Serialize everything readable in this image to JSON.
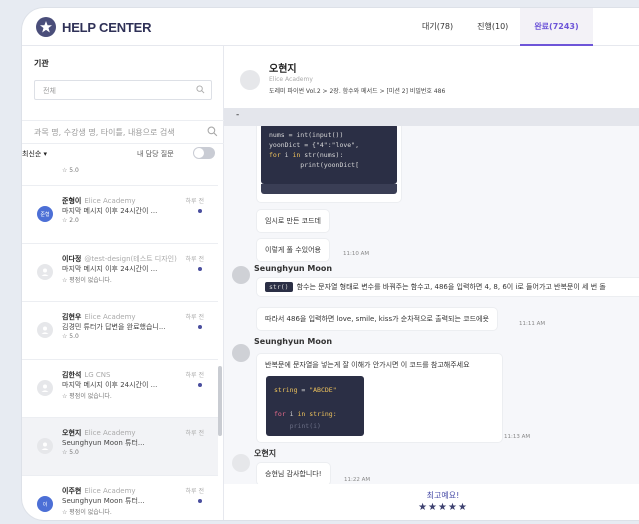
{
  "header": {
    "logo_text": "HELP CENTER",
    "tabs": [
      {
        "label": "대기(78)"
      },
      {
        "label": "진행(10)"
      },
      {
        "label": "완료(7243)"
      }
    ]
  },
  "sidebar": {
    "org_label": "기관",
    "org_value": "전체",
    "search_placeholder": "과목 명, 수강생 명, 타이틀, 내용으로 검색",
    "sort_label": "최신순 ▾",
    "mine_label": "내 담당 질문",
    "items": [
      {
        "name": "",
        "org": "",
        "time": "",
        "preview": "",
        "rating": "☆ 5.0",
        "avatar": "",
        "dot": false
      },
      {
        "name": "준형이",
        "org": "Elice Academy",
        "time": "하루 전",
        "preview": "마지막 메시지 이후 24시간이 ...",
        "rating": "☆ 2.0",
        "avatar": "준형",
        "dot": true
      },
      {
        "name": "이다정",
        "org": "@test-design(테스트 디자인)",
        "time": "하루 전",
        "preview": "마지막 메시지 이후 24시간이 ...",
        "rating": "☆ 평점이 없습니다.",
        "avatar": "",
        "dot": true
      },
      {
        "name": "김현우",
        "org": "Elice Academy",
        "time": "하루 전",
        "preview": "김경민 튜터가 답변을 완료했습니...",
        "rating": "☆ 5.0",
        "avatar": "",
        "dot": true
      },
      {
        "name": "김한석",
        "org": "LG CNS",
        "time": "하루 전",
        "preview": "마지막 메시지 이후 24시간이 ...",
        "rating": "☆ 평점이 없습니다.",
        "avatar": "",
        "dot": true
      },
      {
        "name": "오현지",
        "org": "Elice Academy",
        "time": "하루 전",
        "preview": "Seunghyun Moon 튜터...",
        "rating": "☆ 5.0",
        "avatar": "",
        "dot": false
      },
      {
        "name": "이주현",
        "org": "Elice Academy",
        "time": "하루 전",
        "preview": "Seunghyun Moon 튜터...",
        "rating": "☆ 평점이 없습니다.",
        "avatar": "이",
        "dot": true
      }
    ]
  },
  "chat": {
    "name": "오현지",
    "org": "Elice Academy",
    "path": "도레미 파이썬 Vol.2  >  2장. 함수와 메서드  >  [미션 2] 비밀번호 486",
    "bar_symbol": "-",
    "code1": {
      "l1": "nums = int(input())",
      "l2": "yoonDict = {\"4\":\"love\",",
      "l3a": "for",
      "l3b": " i ",
      "l3c": "in",
      "l3d": " str(nums):",
      "l4": "        print(yoonDict["
    },
    "msg_temp": "임시로 만든 코드데",
    "msg_unexpected": "이렇게 풀 수있어용",
    "stamp1": "11:10 AM",
    "tutor1": "Seunghyun Moon",
    "tutor_code": "str()",
    "tutor_msg1": "함수는 문자열 형태로 변수를 바꿔주는 함수고, 486을 입력하면 4, 8, 6이 i로 들어가고 반복문이 세 번 돌",
    "tutor_msg2": "따라서 486을 입력하면 love, smile, kiss가 순차적으로 출력되는 코드에욧",
    "stamp2": "11:11 AM",
    "tutor2": "Seunghyun Moon",
    "tutor_msg3": "반복문에 문자열을 넣는게 잘 이해가 안가시면 이 코드를 참고해주세요",
    "code2": {
      "l1a": "string",
      "l1b": " = ",
      "l1c": "\"ABCDE\"",
      "l2a": "for",
      "l2b": " i ",
      "l2c": "in",
      "l2d": " string:",
      "l3": "    print(i)"
    },
    "stamp3": "11:13 AM",
    "student": "오현지",
    "student_msg": "승현님 감사합니다!",
    "stamp4": "11:22 AM",
    "feedback_text": "최고예요!",
    "feedback_stars": "★★★★★"
  }
}
